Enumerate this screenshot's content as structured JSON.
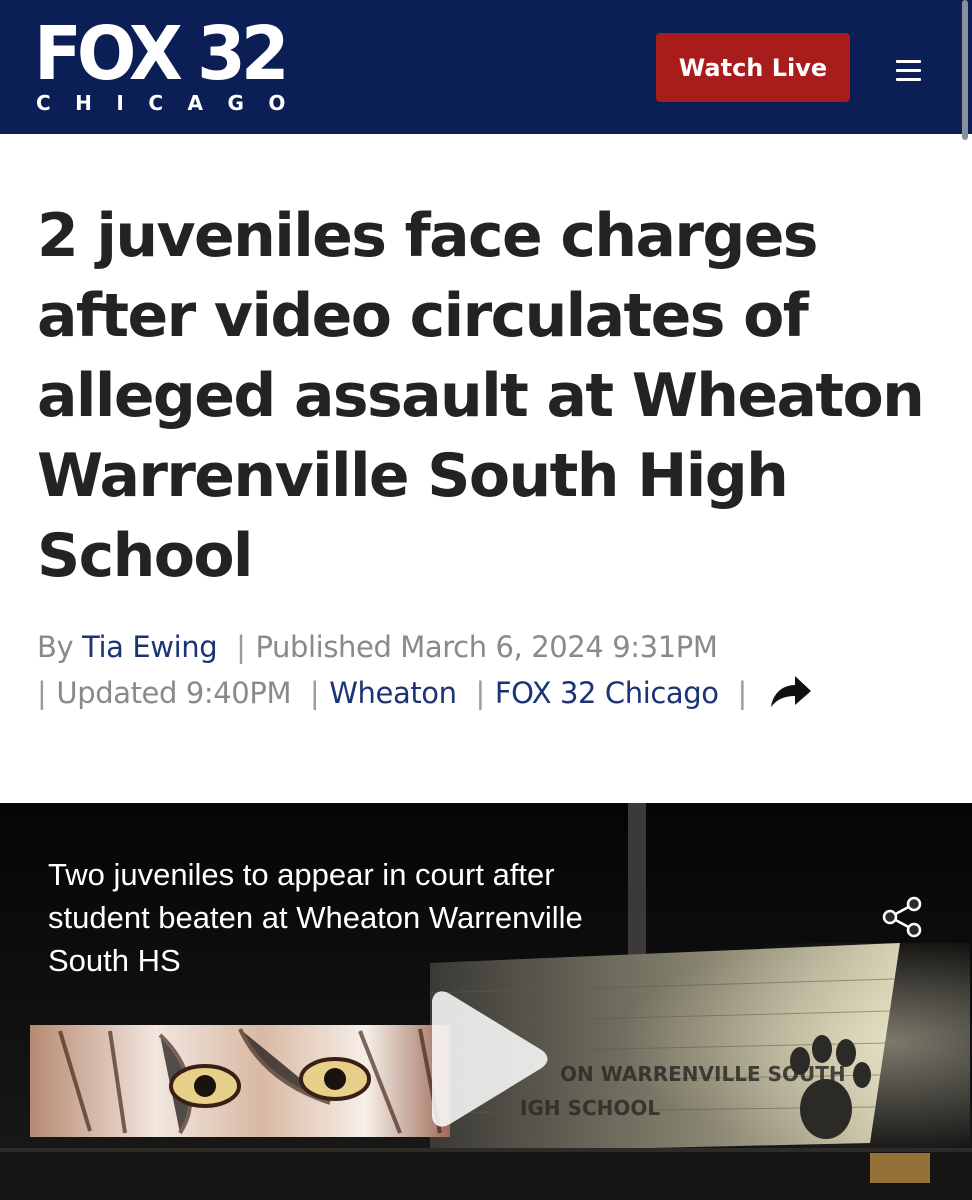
{
  "header": {
    "logo_main": "FOX 32",
    "logo_sub": "CHICAGO",
    "watch_live_label": "Watch Live",
    "brand_color": "#0b1f56",
    "watch_live_color": "#a81c1c"
  },
  "article": {
    "headline": "2 juveniles face charges after video circulates of alleged assault at Wheaton Warrenville South High School",
    "byline_prefix": "By",
    "author": "Tia Ewing",
    "published": "Published March 6, 2024 9:31PM",
    "updated": "Updated 9:40PM",
    "location": "Wheaton",
    "source": "FOX 32 Chicago",
    "separator": "|",
    "link_color": "#1c3475"
  },
  "video": {
    "caption": "Two juveniles to appear in court after student beaten at Wheaton Warrenville South HS",
    "sign_text_line1": "ON WARRENVILLE SOUTH",
    "sign_text_line2": "IGH SCHOOL",
    "share_icon": "share-nodes-icon",
    "play_icon": "play-icon"
  }
}
